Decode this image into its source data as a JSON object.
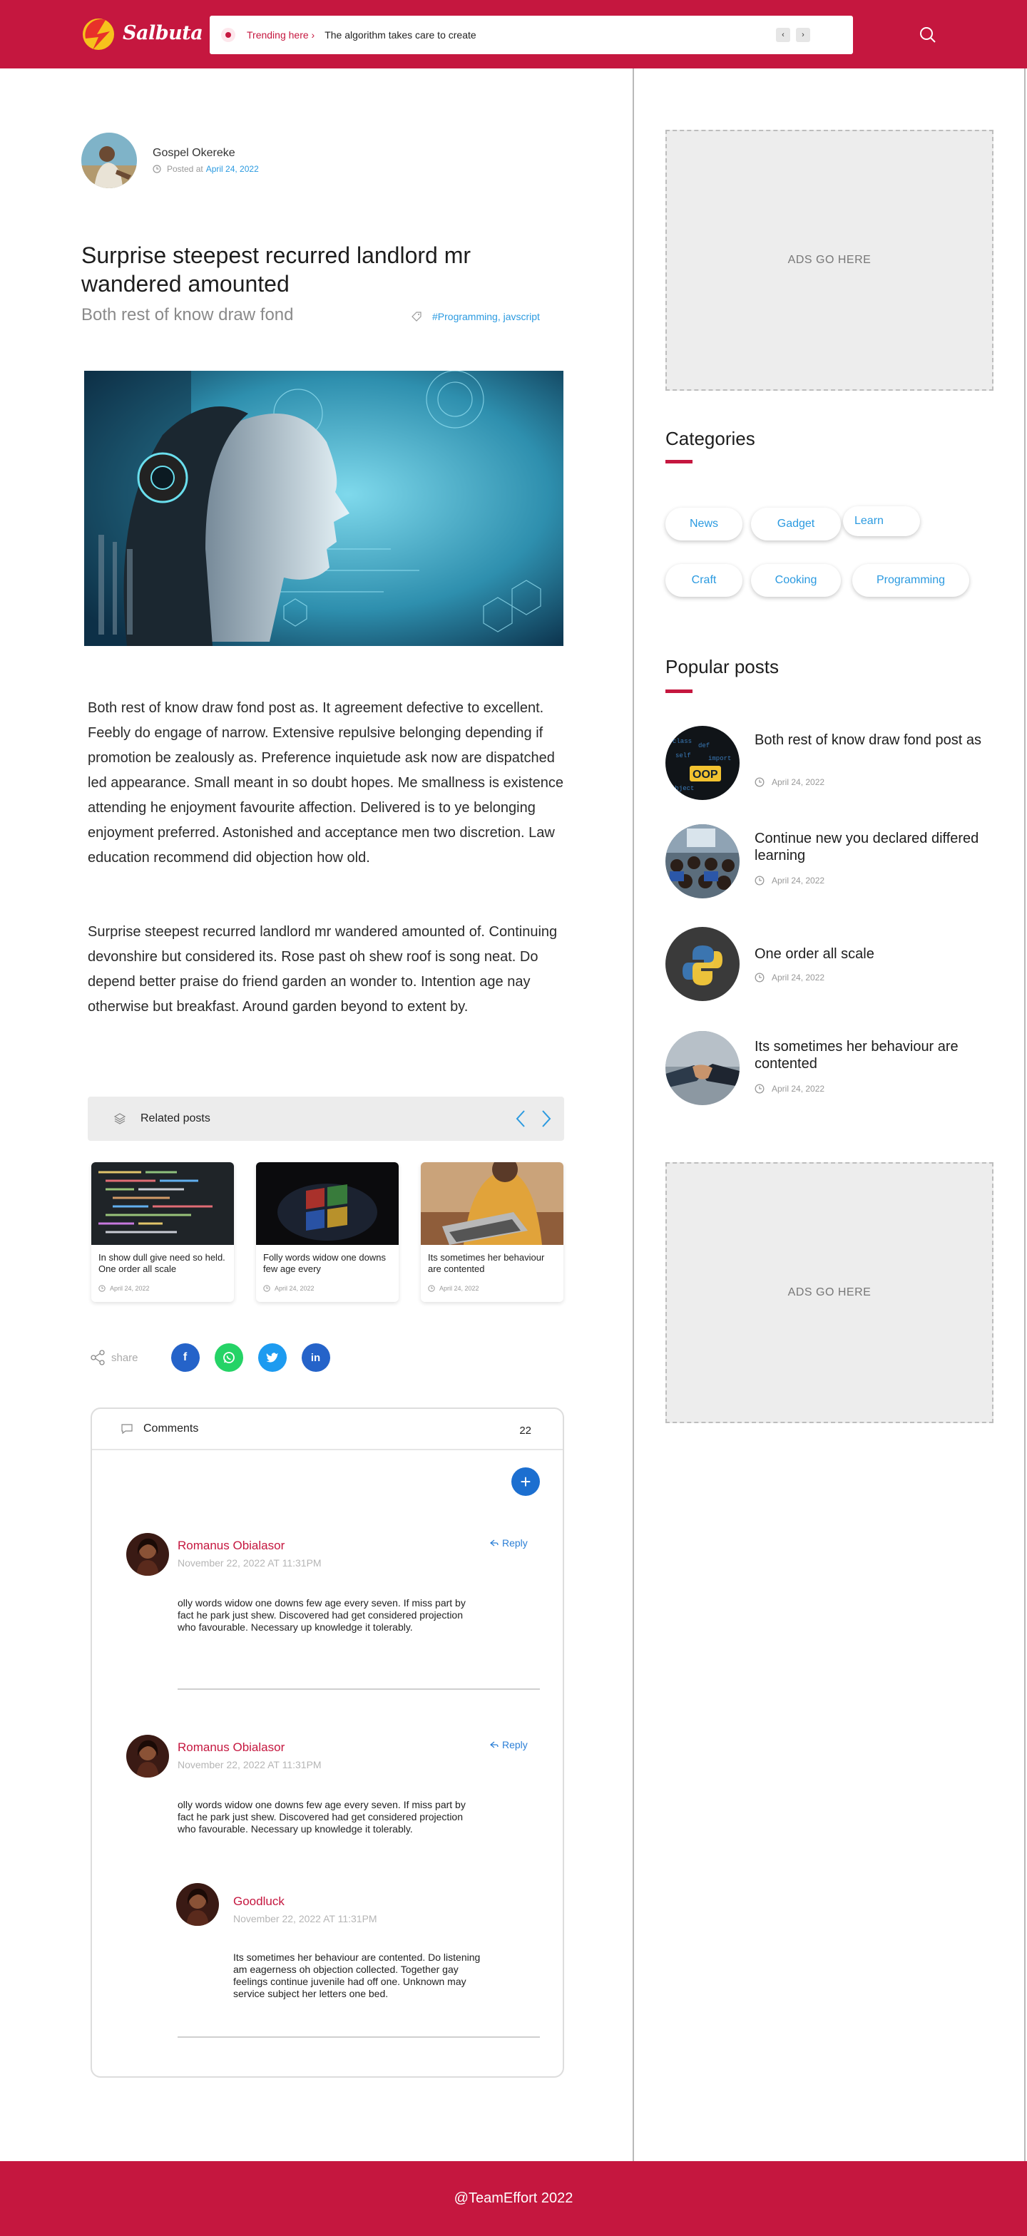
{
  "header": {
    "brand": "Salbuta",
    "trending_label": "Trending here",
    "trending_text": "The algorithm takes care to create",
    "prev_arrow": "‹",
    "next_arrow": "›"
  },
  "article": {
    "author": "Gospel Okereke",
    "posted_prefix": "Posted at",
    "posted_date": "April 24, 2022",
    "title": "Surprise steepest recurred landlord mr wandered amounted",
    "subtitle": "Both rest of know draw fond",
    "tags": "#Programming, javscript",
    "paragraph1": "Both rest of know draw fond post as. It agreement defective to excellent. Feebly do engage of narrow. Extensive repulsive belonging depending if promotion be zealously as. Preference inquietude ask now are dispatched led appearance. Small meant in so doubt hopes. Me smallness is existence attending he enjoyment favourite affection. Delivered is to ye belonging enjoyment preferred. Astonished and acceptance men two discretion. Law education recommend did objection how old.",
    "paragraph2": "Surprise steepest recurred landlord mr wandered amounted of. Continuing devonshire but considered its. Rose past oh shew roof is song neat. Do depend better praise do friend garden an wonder to. Intention age nay otherwise but breakfast. Around garden beyond to extent by."
  },
  "related": {
    "title": "Related posts",
    "posts": [
      {
        "title": "In show dull give need so held. One order all scale",
        "date": "April 24, 2022"
      },
      {
        "title": "Folly words widow one downs few age every",
        "date": "April 24, 2022"
      },
      {
        "title": "Its sometimes her behaviour are contented",
        "date": "April 24, 2022"
      }
    ]
  },
  "share": {
    "label": "share",
    "networks": [
      "facebook",
      "whatsapp",
      "twitter",
      "linkedin"
    ]
  },
  "comments": {
    "title": "Comments",
    "count": "22",
    "add_symbol": "+",
    "reply_label": "Reply",
    "items": [
      {
        "name": "Romanus Obialasor",
        "date": "November 22, 2022 AT 11:31PM",
        "text": "olly words widow one downs few age every seven. If miss part by fact he park just shew. Discovered had get considered projection who favourable. Necessary up knowledge it tolerably."
      },
      {
        "name": "Romanus Obialasor",
        "date": "November 22, 2022 AT 11:31PM",
        "text": "olly words widow one downs few age every seven. If miss part by fact he park just shew. Discovered had get considered projection who favourable. Necessary up knowledge it tolerably."
      },
      {
        "name": "Goodluck",
        "date": "November 22, 2022 AT 11:31PM",
        "text": "Its sometimes her behaviour are contented. Do listening am eagerness oh objection collected. Together gay feelings continue juvenile had off one. Unknown may service subject her letters one bed."
      }
    ]
  },
  "sidebar": {
    "ads_text": "ADS GO HERE",
    "categories_title": "Categories",
    "categories": [
      "News",
      "Gadget",
      "Learn",
      "Craft",
      "Cooking",
      "Programming"
    ],
    "popular_title": "Popular posts",
    "popular": [
      {
        "title": "Both rest of know draw fond post as",
        "date": "April 24, 2022"
      },
      {
        "title": "Continue new you declared differed learning",
        "date": "April 24, 2022"
      },
      {
        "title": "One order all scale",
        "date": "April 24, 2022"
      },
      {
        "title": "Its sometimes her behaviour are contented",
        "date": "April 24, 2022"
      }
    ]
  },
  "footer": {
    "text": "@TeamEffort 2022"
  },
  "colors": {
    "brand": "#c5173f",
    "link": "#2b9ae0",
    "facebook": "#2563c9",
    "whatsapp": "#25d366",
    "twitter": "#1d9bf0",
    "linkedin": "#2563c9"
  }
}
